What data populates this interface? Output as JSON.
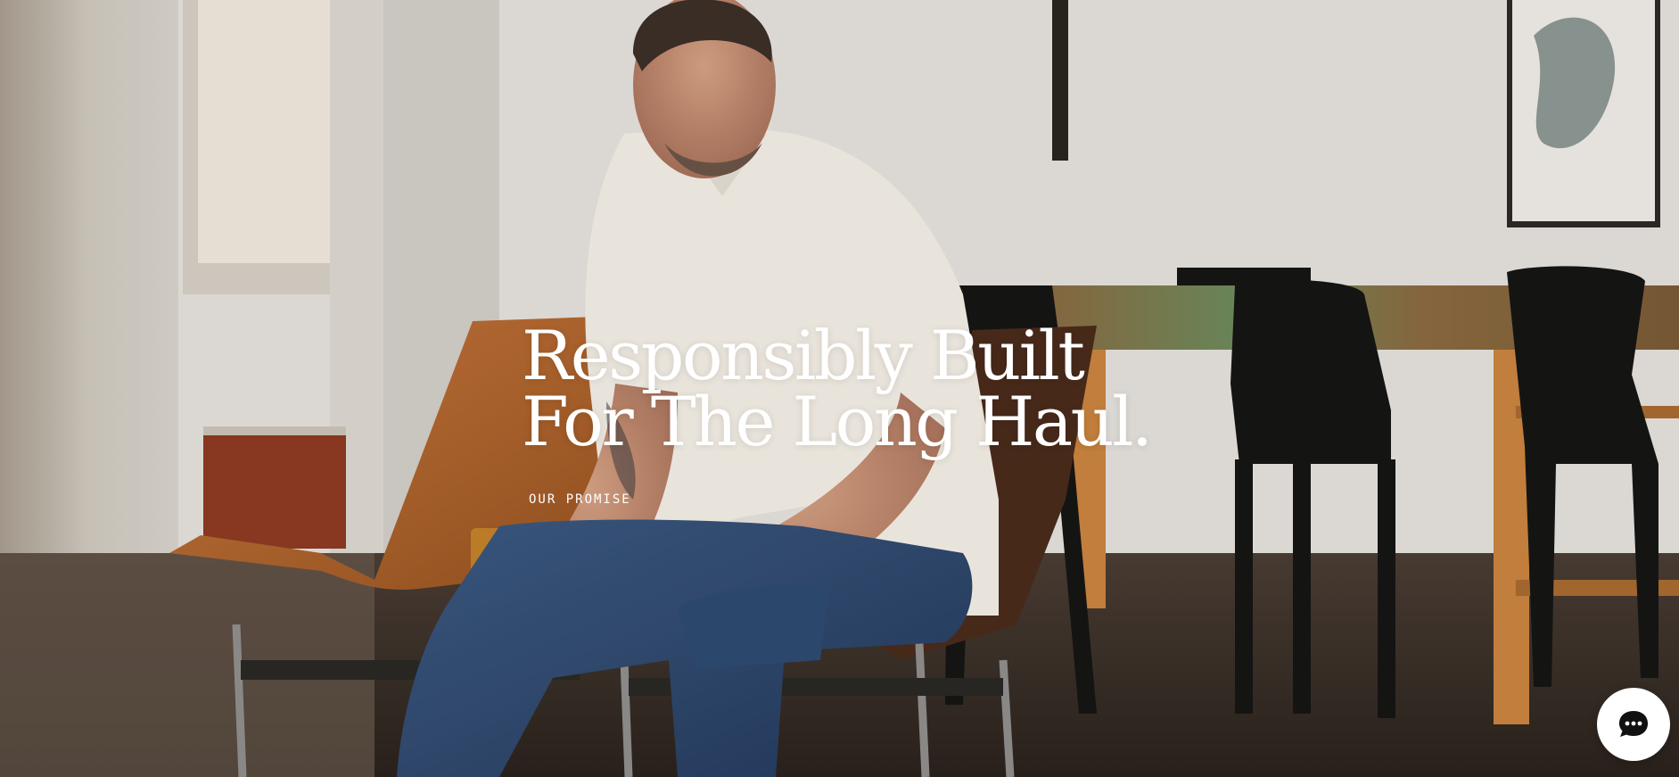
{
  "hero": {
    "headline_line1": "Responsibly Built",
    "headline_line2": "For The Long Haul.",
    "cta_label": "OUR PROMISE",
    "image_subject": "man in white short-sleeve shirt and jeans seated on a leather sling chair in a loft with a wooden dining table and black chairs"
  },
  "chat_widget": {
    "icon": "chat-bubble-icon"
  },
  "colors": {
    "headline_text": "#ffffff",
    "chat_button_bg": "#ffffff",
    "chat_icon": "#111111",
    "leather_chair": "#b56a35"
  }
}
